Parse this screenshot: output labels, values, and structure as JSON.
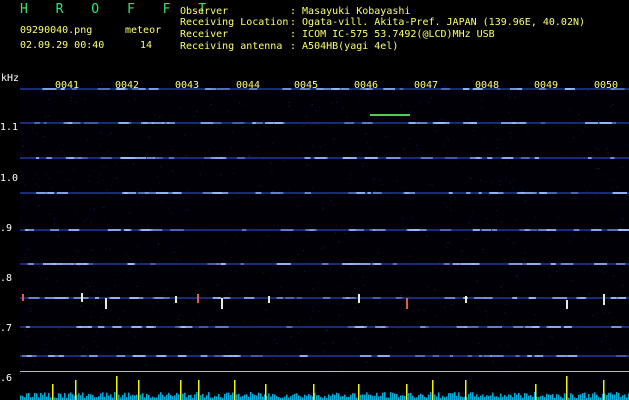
{
  "header": {
    "app_name": "H R O F F T",
    "filename": "09290040.png",
    "timestamp": "02.09.29 00:40",
    "count_label": "meteor",
    "count_value": "14",
    "fields": [
      {
        "label": "Observer",
        "value": ": Masayuki Kobayashi"
      },
      {
        "label": "Receiving Location",
        "value": ": Ogata-vill. Akita-Pref. JAPAN (139.96E, 40.02N)"
      },
      {
        "label": "Receiver",
        "value": ": ICOM IC-575 53.7492(@LCD)MHz USB"
      },
      {
        "label": "Receiving antenna",
        "value": ": A504HB(yagi 4el)"
      }
    ]
  },
  "spectrogram": {
    "y_unit": "kHz",
    "y_ticks": [
      "1.1",
      "1.0",
      ".9",
      ".8",
      ".7",
      ".6"
    ],
    "x_ticks": [
      "0041",
      "0042",
      "0043",
      "0044",
      "0045",
      "0046",
      "0047",
      "0048",
      "0049",
      "0050"
    ],
    "colors": {
      "background": "#000006",
      "noise_line": "#2a4fd9",
      "noise_bright": "#9fc0ff",
      "meteor": "#ffffff",
      "meteor_alt": "#ff6644",
      "meteor_green": "#66ff66",
      "trace": "#00c8ff",
      "trace_tick": "#ffff00"
    }
  }
}
